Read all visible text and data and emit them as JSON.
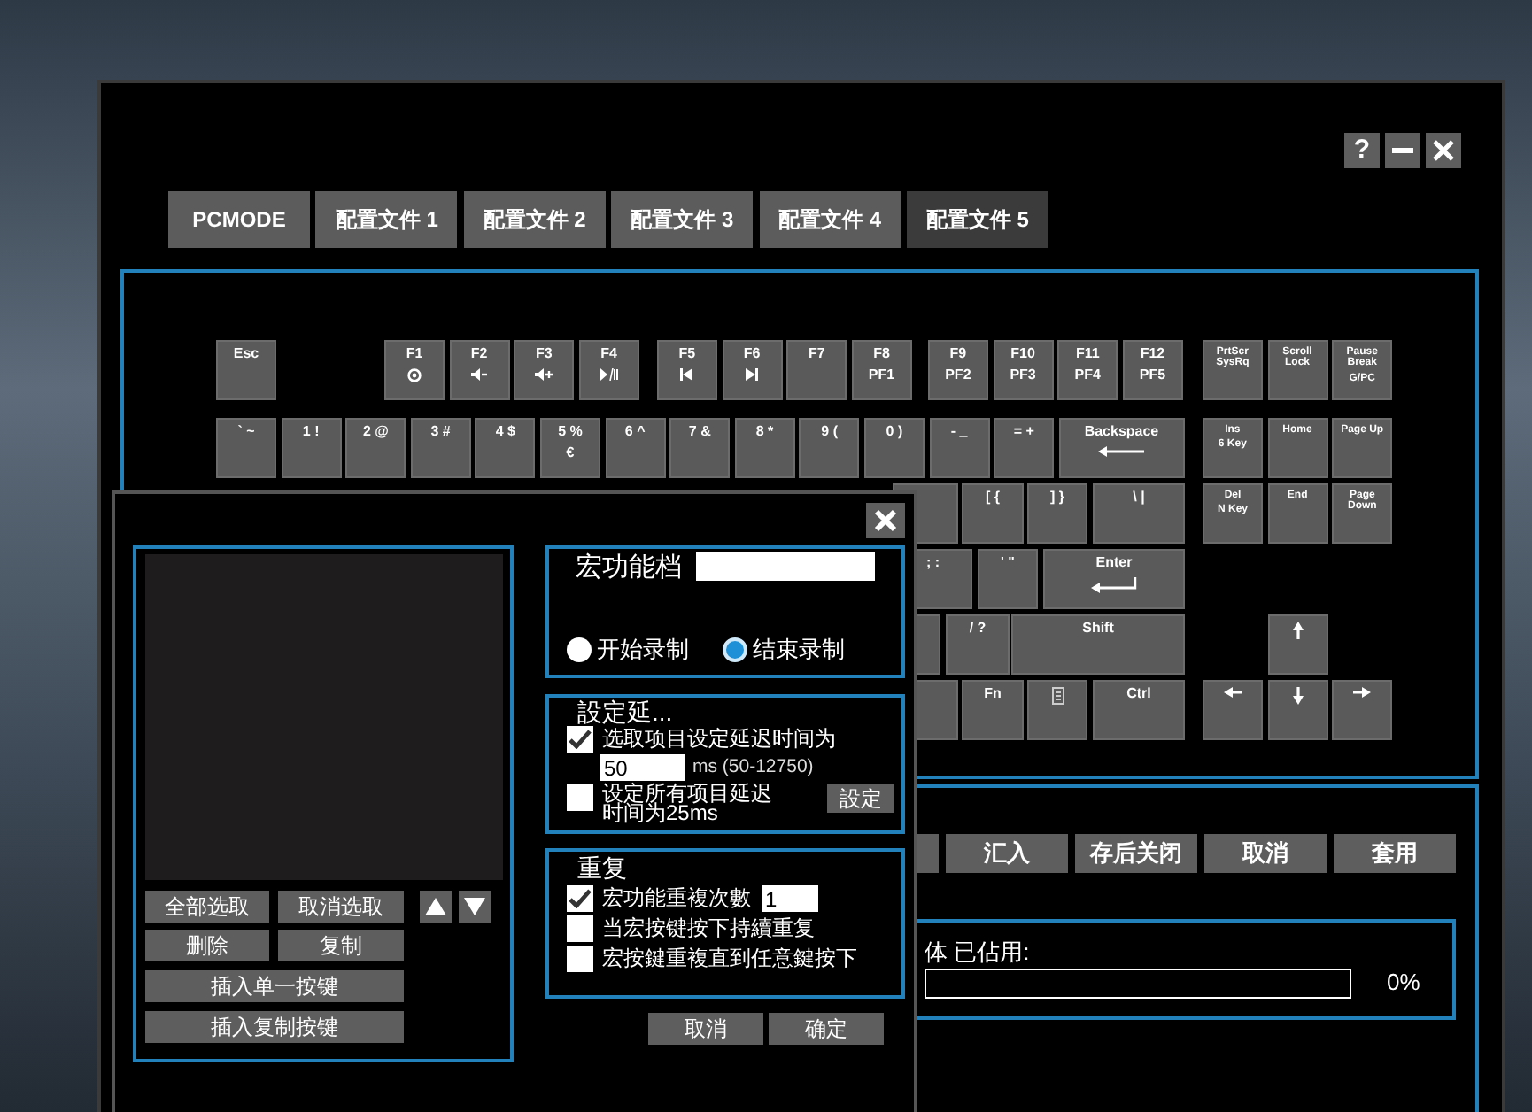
{
  "window": {
    "help_label": "?"
  },
  "tabs": [
    {
      "label": "PCMODE",
      "selected": false
    },
    {
      "label": "配置文件 1",
      "selected": false
    },
    {
      "label": "配置文件 2",
      "selected": false
    },
    {
      "label": "配置文件 3",
      "selected": false
    },
    {
      "label": "配置文件 4",
      "selected": false
    },
    {
      "label": "配置文件 5",
      "selected": true
    }
  ],
  "keyboard": {
    "keys": [
      {
        "label": "Esc"
      },
      {
        "label": "F1"
      },
      {
        "label": "F2"
      },
      {
        "label": "F3"
      },
      {
        "label": "F4"
      },
      {
        "label": "F5"
      },
      {
        "label": "F6"
      },
      {
        "label": "F7"
      },
      {
        "label": "F8",
        "sub": "PF1"
      },
      {
        "label": "F9",
        "sub": "PF2"
      },
      {
        "label": "F10",
        "sub": "PF3"
      },
      {
        "label": "F11",
        "sub": "PF4"
      },
      {
        "label": "F12",
        "sub": "PF5"
      },
      {
        "label": "PrtScr SysRq"
      },
      {
        "label": "Scroll Lock"
      },
      {
        "label": "Pause Break",
        "sub": "G/PC"
      },
      {
        "label": "` ~"
      },
      {
        "label": "1 !"
      },
      {
        "label": "2 @"
      },
      {
        "label": "3 #"
      },
      {
        "label": "4 $"
      },
      {
        "label": "5 %",
        "sub": "€"
      },
      {
        "label": "6 ^"
      },
      {
        "label": "7 &"
      },
      {
        "label": "8 *"
      },
      {
        "label": "9 ("
      },
      {
        "label": "0 )"
      },
      {
        "label": "- _"
      },
      {
        "label": "= +"
      },
      {
        "label": "Backspace"
      },
      {
        "label": "Ins",
        "sub": "6 Key"
      },
      {
        "label": "Home"
      },
      {
        "label": "Page Up"
      },
      {
        "label": "[ {"
      },
      {
        "label": "] }"
      },
      {
        "label": "\\ |"
      },
      {
        "label": "Del",
        "sub": "N Key"
      },
      {
        "label": "End"
      },
      {
        "label": "Page Down"
      },
      {
        "label": "; :"
      },
      {
        "label": "' \""
      },
      {
        "label": "Enter"
      },
      {
        "label": "/ ?"
      },
      {
        "label": "Shift"
      },
      {
        "label": "Fn"
      },
      {
        "label": "Ctrl"
      }
    ]
  },
  "actions": [
    "汇入",
    "存后关闭",
    "取消",
    "套用"
  ],
  "memory": {
    "label": "体 已佔用:",
    "level": 0,
    "reading": "0%"
  },
  "dialog": {
    "list_buttons": [
      "全部选取",
      "取消选取",
      "删除",
      "复制",
      "插入单一按键",
      "插入复制按键"
    ],
    "name_label": "宏功能档",
    "record": [
      {
        "label": "开始录制",
        "selected": false
      },
      {
        "label": "结束录制",
        "selected": true
      }
    ],
    "delay": {
      "title": "設定延...",
      "options": [
        {
          "kind": "delay",
          "label": "选取项目设定延迟时间为",
          "checked": true,
          "value": "50",
          "unit": "ms (50-12750)"
        },
        {
          "kind": "plain",
          "label": "设定所有项目延迟时间为25ms",
          "checked": false
        }
      ],
      "button": "設定"
    },
    "repeat": {
      "title": "重复",
      "options": [
        {
          "kind": "count",
          "label": "宏功能重複次數",
          "checked": true,
          "value": "1"
        },
        {
          "kind": "plain",
          "label": "当宏按键按下持續重复",
          "checked": false
        },
        {
          "kind": "plain",
          "label": "宏按鍵重複直到任意鍵按下",
          "checked": false
        }
      ]
    },
    "buttons": [
      "取消",
      "确定"
    ]
  }
}
